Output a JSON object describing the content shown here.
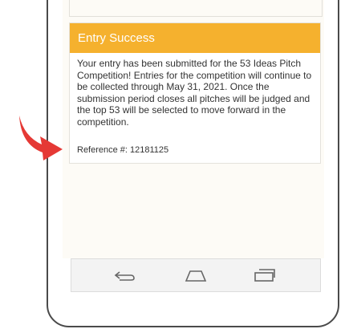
{
  "dialog": {
    "title": "Entry Success",
    "message": "Your entry has been submitted for the 53 Ideas Pitch Competition! Entries for the competition will continue to be collected through May 31, 2021. Once the submission period closes all pitches will be judged and the top 53 will be selected to move forward in the competition.",
    "reference": "Reference #: 12181125"
  },
  "colors": {
    "header_bg": "#f5b12e",
    "arrow": "#e53935"
  },
  "navbar": {
    "icons": [
      "back-icon",
      "home-icon",
      "recent-apps-icon"
    ]
  }
}
